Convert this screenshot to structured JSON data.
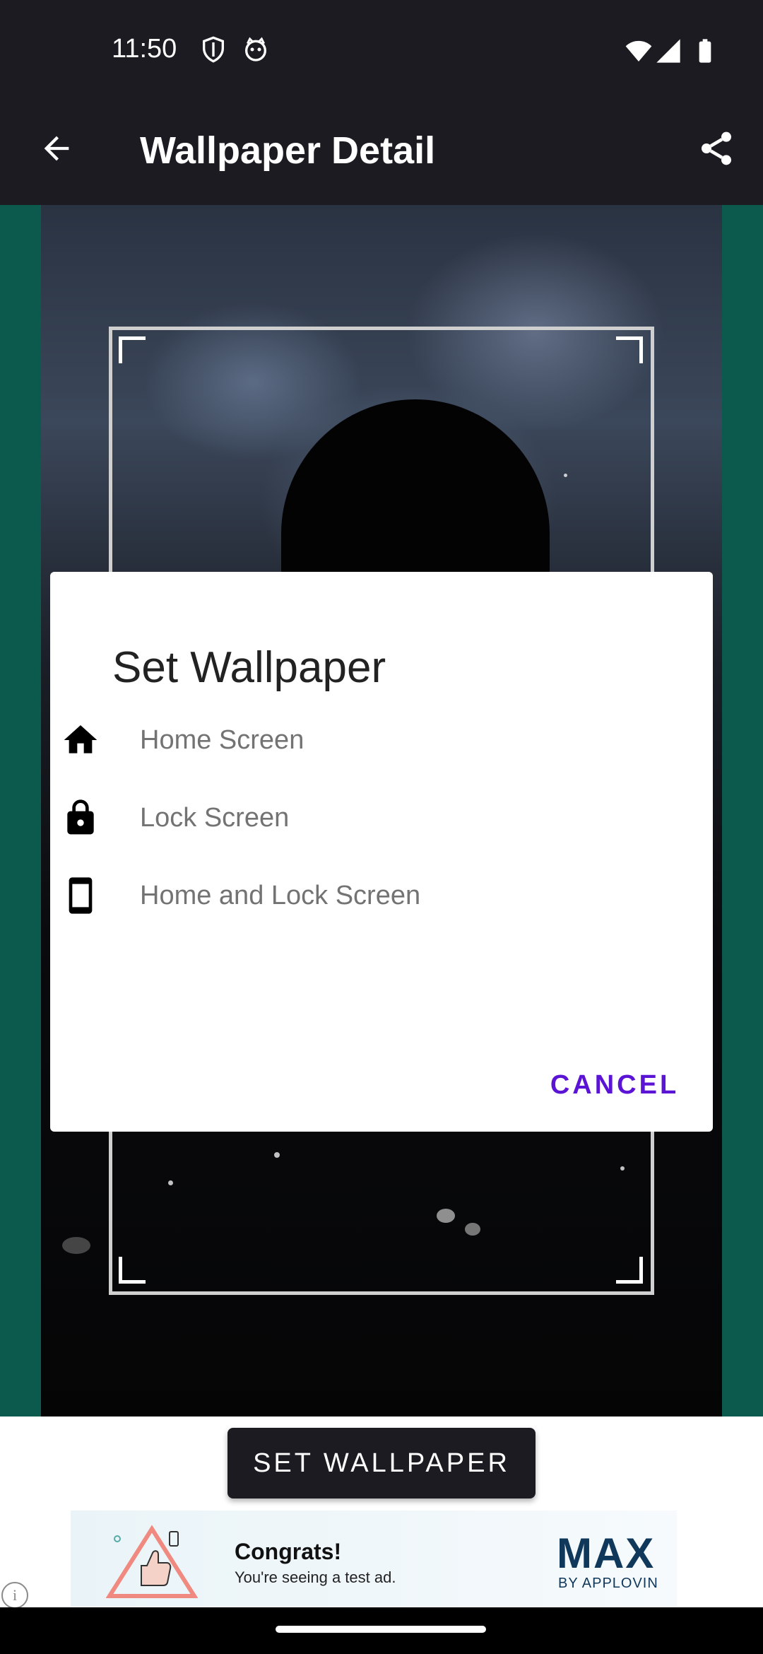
{
  "status_bar": {
    "time": "11:50",
    "icons": [
      "shield-icon",
      "cat-face-icon",
      "wifi-icon",
      "signal-icon",
      "battery-icon"
    ]
  },
  "app_bar": {
    "title": "Wallpaper Detail",
    "back_icon": "arrow-back-icon",
    "share_icon": "share-icon"
  },
  "dialog": {
    "title": "Set Wallpaper",
    "options": [
      {
        "label": "Home Screen",
        "icon": "home-icon"
      },
      {
        "label": "Lock Screen",
        "icon": "lock-icon"
      },
      {
        "label": "Home and Lock Screen",
        "icon": "phone-icon"
      }
    ],
    "cancel_label": "CANCEL",
    "accent_color": "#5b13d6"
  },
  "set_wallpaper_button": {
    "label": "SET WALLPAPER"
  },
  "ad": {
    "headline": "Congrats!",
    "subline": "You're seeing a test ad.",
    "brand": "MAX",
    "brand_by": "BY APPLOVIN",
    "info_icon": "info-icon",
    "info_glyph": "i"
  },
  "colors": {
    "app_bar": "#1b1b21",
    "side_background": "#0c5a4e",
    "button": "#1b1b21"
  }
}
